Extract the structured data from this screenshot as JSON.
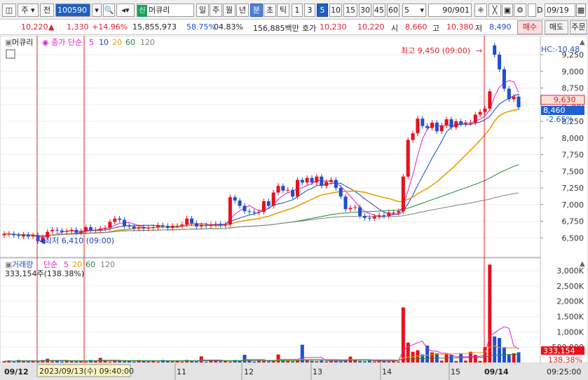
{
  "toolbar": {
    "market": "주",
    "market2": "전",
    "code": "100590",
    "name": "머큐리",
    "name_tag": "신",
    "periods": [
      "일",
      "주",
      "월",
      "년",
      "분",
      "초",
      "틱"
    ],
    "active_period": "분",
    "minutes": [
      "1",
      "3",
      "5",
      "10",
      "15",
      "30",
      "45",
      "60"
    ],
    "active_minute": "5",
    "interval_value": "5",
    "count": "90",
    "count_total": "/901",
    "date": "09/19",
    "date_check": "D"
  },
  "quote": {
    "price": "10,220",
    "arrow": "▲",
    "change": "1,330",
    "change_pct": "+14.96%",
    "volume": "15,855,973",
    "ratio": "58.75%",
    "ratio2": "04.83%",
    "amount": "156,885백만",
    "ask_label": "호가",
    "ask1": "10,230",
    "ask2": "10,220",
    "open_label": "시",
    "open": "8,660",
    "high_label": "고",
    "high": "10,380",
    "low_label": "저",
    "low": "8,490",
    "buy_label": "매수",
    "sell_label": "매도",
    "order_label": "주문"
  },
  "price_panel": {
    "stock_label": "머큐리",
    "ma_label": "종가 단순",
    "ma_periods": [
      "5",
      "10",
      "20",
      "60",
      "120"
    ],
    "high_annot": "최고 9,450 (09:00)",
    "low_annot": "최저 6,410 (09:00)",
    "last_high_box": "9,630",
    "current_box": "8,460",
    "current_pct": "-2.65%",
    "hc_label": "HC:-10.48"
  },
  "volume_panel": {
    "label": "거래량",
    "ma_label": "단순",
    "ma_periods": [
      "5",
      "20",
      "60",
      "120"
    ],
    "value_text": "333,154주(138.38%)",
    "current_box": "333,154",
    "current_pct": "138.38%"
  },
  "time_axis": {
    "start_label": "09/12",
    "cursor_label": "2023/09/13(수) 09:40:00",
    "day_labels": [
      "11",
      "12",
      "13",
      "14",
      "15"
    ],
    "end_label": "09/14",
    "corner_label": "09:25:00"
  },
  "chart_data": [
    {
      "type": "candlestick",
      "title": "머큐리",
      "ylim": [
        6250,
        9450
      ],
      "y_ticks": [
        6500,
        6750,
        7000,
        7250,
        7500,
        7750,
        8000,
        8250,
        8500,
        8750,
        9000,
        9250
      ],
      "high": 9450,
      "low": 6410,
      "series": [
        {
          "name": "5",
          "color": "#e01ec8"
        },
        {
          "name": "10",
          "color": "#1f3fc0"
        },
        {
          "name": "20",
          "color": "#e8a000"
        },
        {
          "name": "60",
          "color": "#1a8a3a"
        },
        {
          "name": "120",
          "color": "#808080"
        }
      ]
    },
    {
      "type": "bar",
      "title": "거래량",
      "y_ticks_label": [
        "500,000",
        "1,000K",
        "1,500K",
        "2,000K",
        "2,500K",
        "3,000K"
      ],
      "ylim": [
        0,
        3300000
      ],
      "max_bar": 3200000,
      "current": 333154
    }
  ],
  "colors": {
    "up": "#e8101c",
    "down": "#1f4fd0",
    "accent": "#1f5fbf"
  }
}
